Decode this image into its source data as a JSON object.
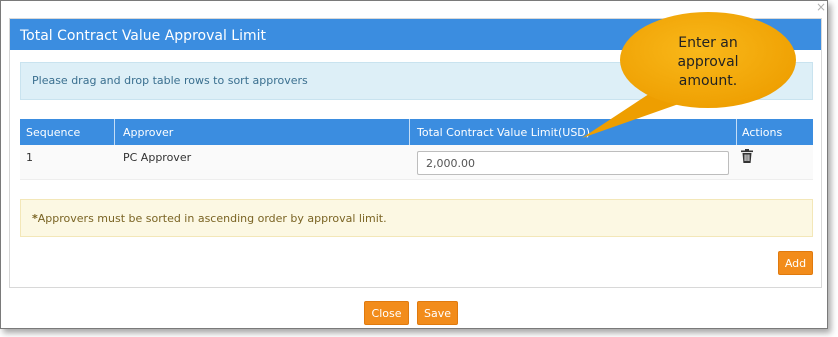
{
  "dialog": {
    "title": "Total Contract Value Approval Limit",
    "close_glyph": "×",
    "info_message": "Please drag and drop table rows to sort approvers",
    "table": {
      "headers": [
        "Sequence",
        "Approver",
        "Total Contract Value Limit(USD)",
        "Actions"
      ],
      "rows": [
        {
          "sequence": "1",
          "approver": "PC Approver",
          "limit": "2,000.00",
          "action_icon": "trash-icon"
        }
      ]
    },
    "warning": {
      "asterisk": "*",
      "text": "Approvers must be sorted in ascending order by approval limit."
    },
    "add_label": "Add"
  },
  "footer": {
    "close_label": "Close",
    "save_label": "Save"
  },
  "callout": {
    "lines": [
      "Enter an",
      "approval",
      "amount."
    ]
  },
  "colors": {
    "header_blue": "#3b8de0",
    "button_orange": "#f28c1b",
    "callout_orange": "#f5a800",
    "info_bg": "#ddeff7",
    "warning_bg": "#fcf8e3"
  }
}
